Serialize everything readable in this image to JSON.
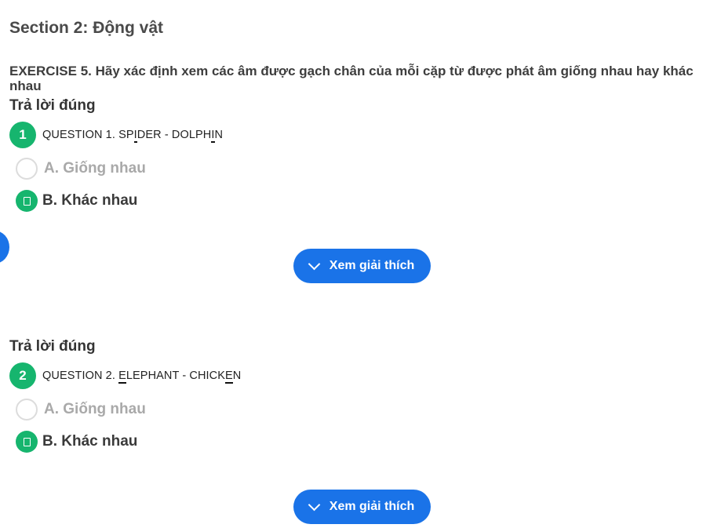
{
  "section": {
    "title": "Section 2: Động vật"
  },
  "exercise": {
    "text": "EXERCISE 5. Hãy xác định xem các âm được gạch chân của mỗi cặp từ được phát âm giống nhau hay khác nhau"
  },
  "questions": [
    {
      "status": "Trả lời đúng",
      "number": "1",
      "prefix": "QUESTION 1. ",
      "word1": [
        "SP",
        "I",
        "DER"
      ],
      "separator": " - ",
      "word2": [
        "DOLPH",
        "I",
        "N"
      ],
      "options": [
        "A. Giống nhau",
        "B. Khác nhau"
      ],
      "selected": "B",
      "explain_label": "Xem giải thích"
    },
    {
      "status": "Trả lời đúng",
      "number": "2",
      "prefix": "QUESTION 2. ",
      "word1": [
        "",
        "E",
        "LEPHANT"
      ],
      "separator": " - ",
      "word2": [
        "CHICK",
        "E",
        "N"
      ],
      "options": [
        "A. Giống nhau",
        "B. Khác nhau"
      ],
      "selected": "B",
      "explain_label": "Xem giải thích"
    }
  ],
  "icons": {
    "chevron": "chevron-down-icon",
    "check": "check-icon"
  },
  "colors": {
    "correct": "#16b56e",
    "primary": "#1a73e8"
  }
}
